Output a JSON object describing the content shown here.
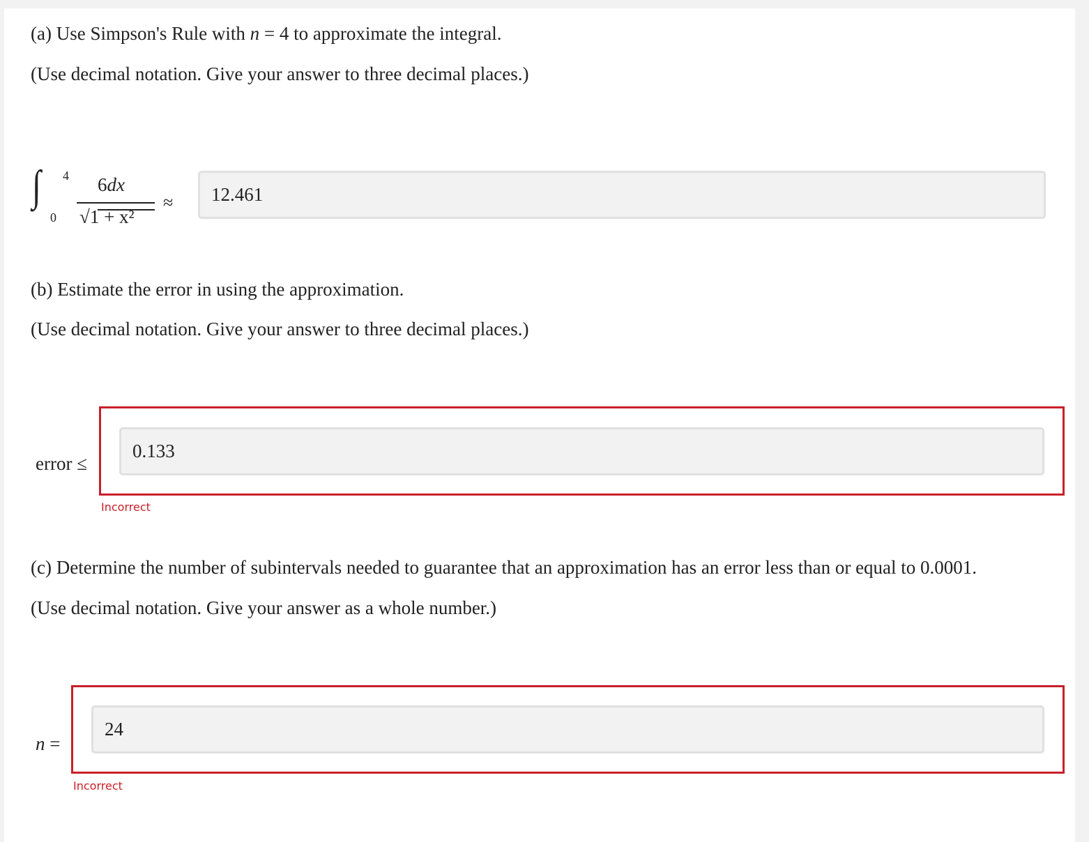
{
  "part_a": {
    "prompt_pre": "(a) Use Simpson's Rule with ",
    "prompt_var": "n",
    "prompt_eq": " = ",
    "prompt_n": "4",
    "prompt_post": " to approximate the integral.",
    "instruction": "(Use decimal notation. Give your answer to three decimal places.)",
    "integral": {
      "upper_limit": "4",
      "lower_limit": "0",
      "numerator_coef": "6",
      "numerator_var": "dx",
      "denominator": "√1 + x²",
      "approx_symbol": "≈"
    },
    "answer_value": "12.461"
  },
  "part_b": {
    "prompt": "(b) Estimate the error in using the approximation.",
    "instruction": "(Use decimal notation. Give your answer to three decimal places.)",
    "label": "error ≤",
    "answer_value": "0.133",
    "feedback": "Incorrect"
  },
  "part_c": {
    "prompt": "(c) Determine the number of subintervals needed to guarantee that an approximation has an error less than or equal to 0.0001.",
    "instruction": "(Use decimal notation. Give your answer as a whole number.)",
    "label_var": "n",
    "label_eq": " =",
    "answer_value": "24",
    "feedback": "Incorrect"
  },
  "colors": {
    "error_red": "#c8202a",
    "input_bg": "#f2f2f2",
    "page_bg": "#f2f2f2",
    "card_bg": "#ffffff"
  }
}
